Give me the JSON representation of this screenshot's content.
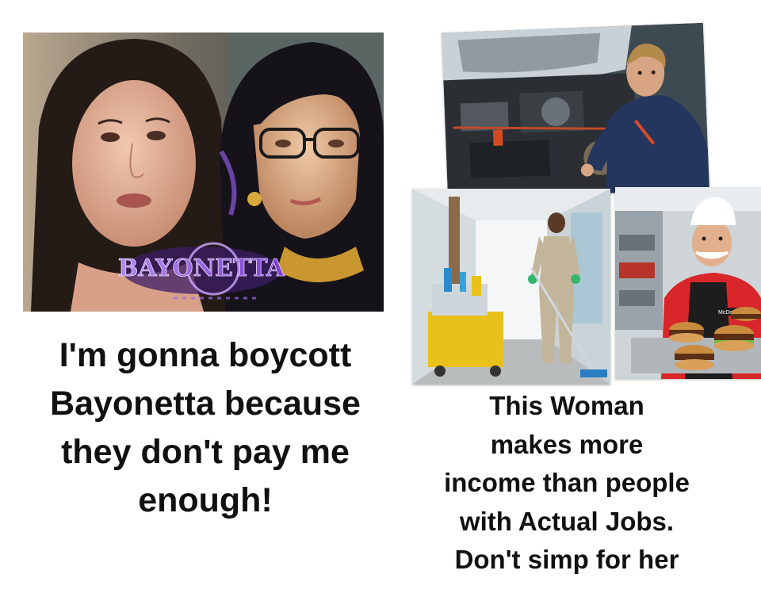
{
  "left_panel": {
    "logo_text": "BAYONETTA",
    "caption": "I'm gonna boycott\nBayonetta because\nthey don't pay me\nenough!"
  },
  "right_panel": {
    "apron_text": "McDon",
    "caption": "This Woman\nmakes more\nincome than people\nwith Actual Jobs.\nDon't simp for her"
  }
}
